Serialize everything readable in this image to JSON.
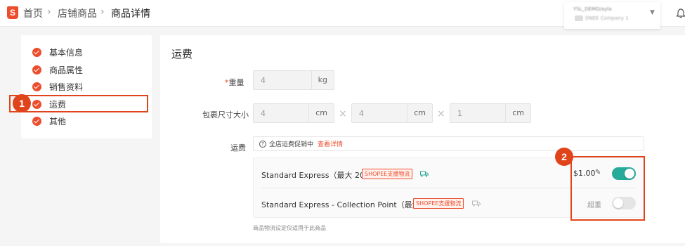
{
  "header": {
    "logo_letter": "S",
    "breadcrumbs": [
      "首页",
      "店铺商品",
      "商品详情"
    ],
    "account": {
      "name": "YSL_DEMO/ayla",
      "shop": "DNEE Company 1"
    }
  },
  "sidebar": {
    "items": [
      {
        "label": "基本信息"
      },
      {
        "label": "商品属性"
      },
      {
        "label": "销售资料"
      },
      {
        "label": "运费"
      },
      {
        "label": "其他"
      }
    ]
  },
  "annotations": {
    "step1": "1",
    "step2": "2"
  },
  "shipping": {
    "section_title": "运费",
    "weight": {
      "required_mark": "*",
      "label": "重量",
      "value": "4",
      "unit": "kg"
    },
    "dimensions": {
      "label": "包裹尺寸大小",
      "fields": [
        {
          "value": "4",
          "unit": "cm"
        },
        {
          "value": "4",
          "unit": "cm"
        },
        {
          "value": "1",
          "unit": "cm"
        }
      ],
      "separator": "×"
    },
    "fee_label": "运费",
    "promo": {
      "icon": "question-icon",
      "text": "全店运费促销中",
      "link": "查看详情"
    },
    "channels": [
      {
        "name": "Standard Express（最大 20kg）",
        "tag": "SHOPEE支援物流",
        "price": "$1.00",
        "enabled": true
      },
      {
        "name": "Standard Express - Collection Point（最大 2kg）",
        "tag": "SHOPEE支援物流",
        "status": "超重",
        "enabled": false
      }
    ],
    "note": "商品物流设定仅适用于此商品"
  },
  "colors": {
    "brand": "#ee4d2d",
    "toggle_on": "#26aa99",
    "highlight": "#e0441b"
  }
}
